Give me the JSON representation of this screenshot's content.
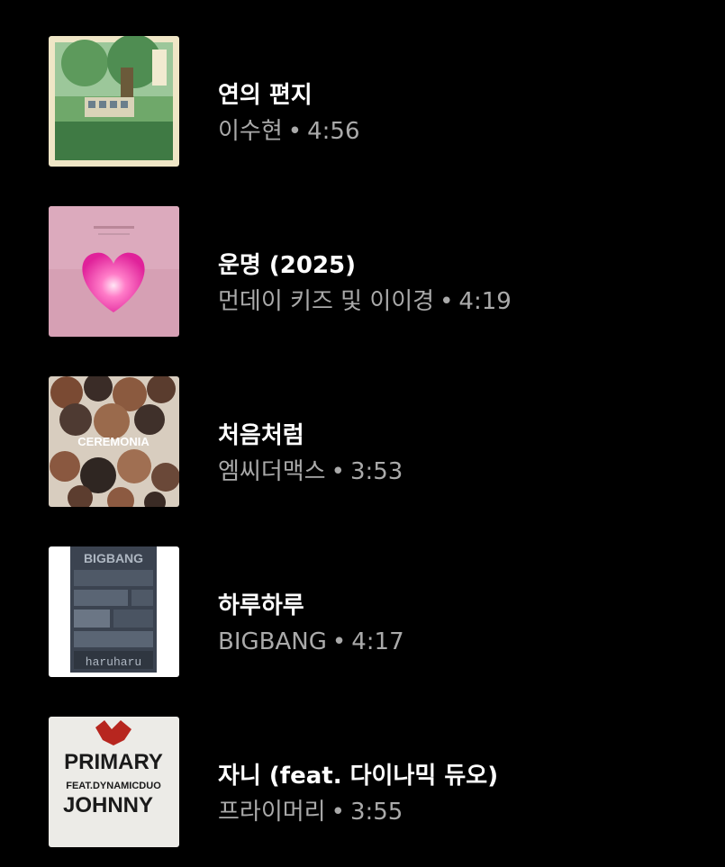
{
  "colors": {
    "background": "#000000",
    "title": "#ffffff",
    "subtitle": "#aaaaaa"
  },
  "tracks": [
    {
      "title": "연의 편지",
      "artist": "이수현",
      "separator": "•",
      "duration": "4:56",
      "art": "forest-bus-illustration"
    },
    {
      "title": "운명 (2025)",
      "artist": "먼데이 키즈 및 이이경",
      "separator": "•",
      "duration": "4:19",
      "art": "pink-heart"
    },
    {
      "title": "처음처럼",
      "artist": "엠씨더맥스",
      "separator": "•",
      "duration": "3:53",
      "art": "ceremonia-cover",
      "art_text": "CEREMONIA"
    },
    {
      "title": "하루하루",
      "artist": "BIGBANG",
      "separator": "•",
      "duration": "4:17",
      "art": "bigbang-cover",
      "art_text": "BIGBANG"
    },
    {
      "title": "자니 (feat. 다이나믹 듀오)",
      "artist": "프라이머리",
      "separator": "•",
      "duration": "3:55",
      "art": "primary-johnny-cover",
      "art_text": "PRIMARY"
    }
  ]
}
